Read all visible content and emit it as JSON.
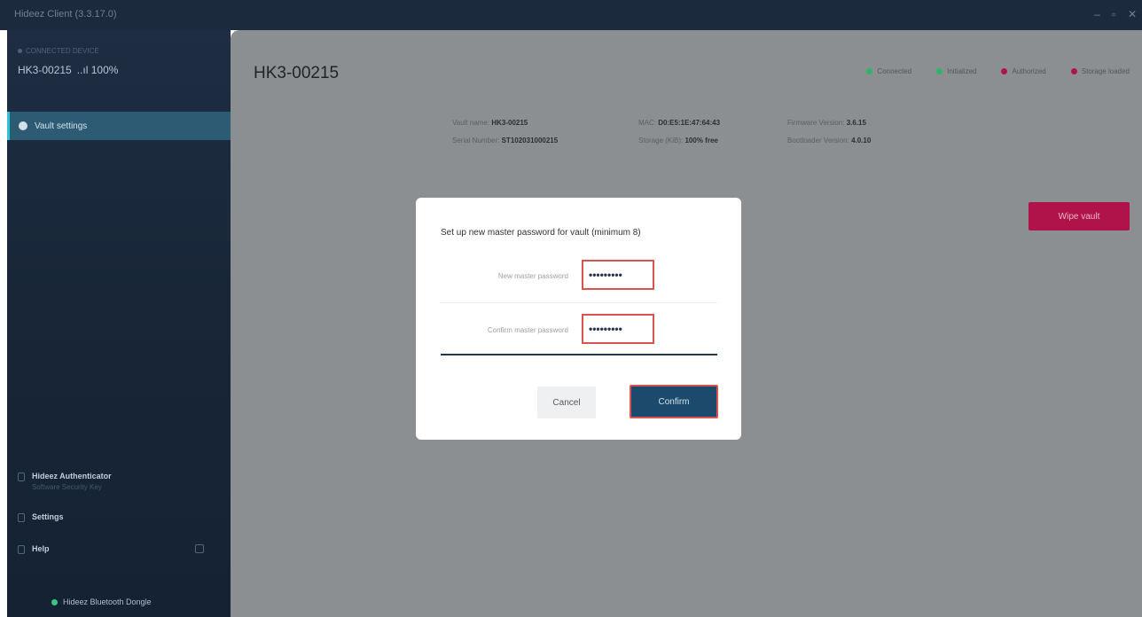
{
  "window": {
    "title": "Hideez Client (3.3.17.0)",
    "controls": [
      "–",
      "▫",
      "✕"
    ]
  },
  "sidebar": {
    "device_subtitle": "CONNECTED DEVICE",
    "device_name": "HK3-00215",
    "device_signal": "..ıl 100%",
    "nav_items": [
      {
        "label": "Vault settings",
        "icon": "gear-icon",
        "active": true
      }
    ],
    "bottom": {
      "authenticator_title": "Hideez Authenticator",
      "authenticator_sub": "Software Security Key",
      "settings": "Settings",
      "help": "Help",
      "dongle": "Hideez Bluetooth Dongle"
    },
    "colors": {
      "active_accent": "#2ec4d6",
      "dongle_status": "#39c77d"
    }
  },
  "main": {
    "title": "HK3-00215",
    "statuses": [
      {
        "label": "Connected",
        "color": "#2fb36a"
      },
      {
        "label": "Initialized",
        "color": "#2fb36a"
      },
      {
        "label": "Authorized",
        "color": "#b0124a"
      },
      {
        "label": "Storage loaded",
        "color": "#b0124a"
      }
    ],
    "info": {
      "vault_name_label": "Vault name:",
      "vault_name": "HK3-00215",
      "mac_label": "MAC:",
      "mac": "D0:E5:1E:47:64:43",
      "firmware_label": "Firmware Version:",
      "firmware": "3.6.15",
      "serial_label": "Serial Number:",
      "serial": "ST102031000215",
      "storage_label": "Storage (KiB):",
      "storage": "100% free",
      "bootloader_label": "Bootloader Version:",
      "bootloader": "4.0.10"
    },
    "wipe_button": "Wipe vault"
  },
  "modal": {
    "title": "Set up new master password for vault (minimum 8)",
    "new_password_label": "New master password",
    "new_password_value": "•••••••••",
    "confirm_password_label": "Confirm master password",
    "confirm_password_value": "•••••••••",
    "cancel": "Cancel",
    "confirm": "Confirm"
  }
}
